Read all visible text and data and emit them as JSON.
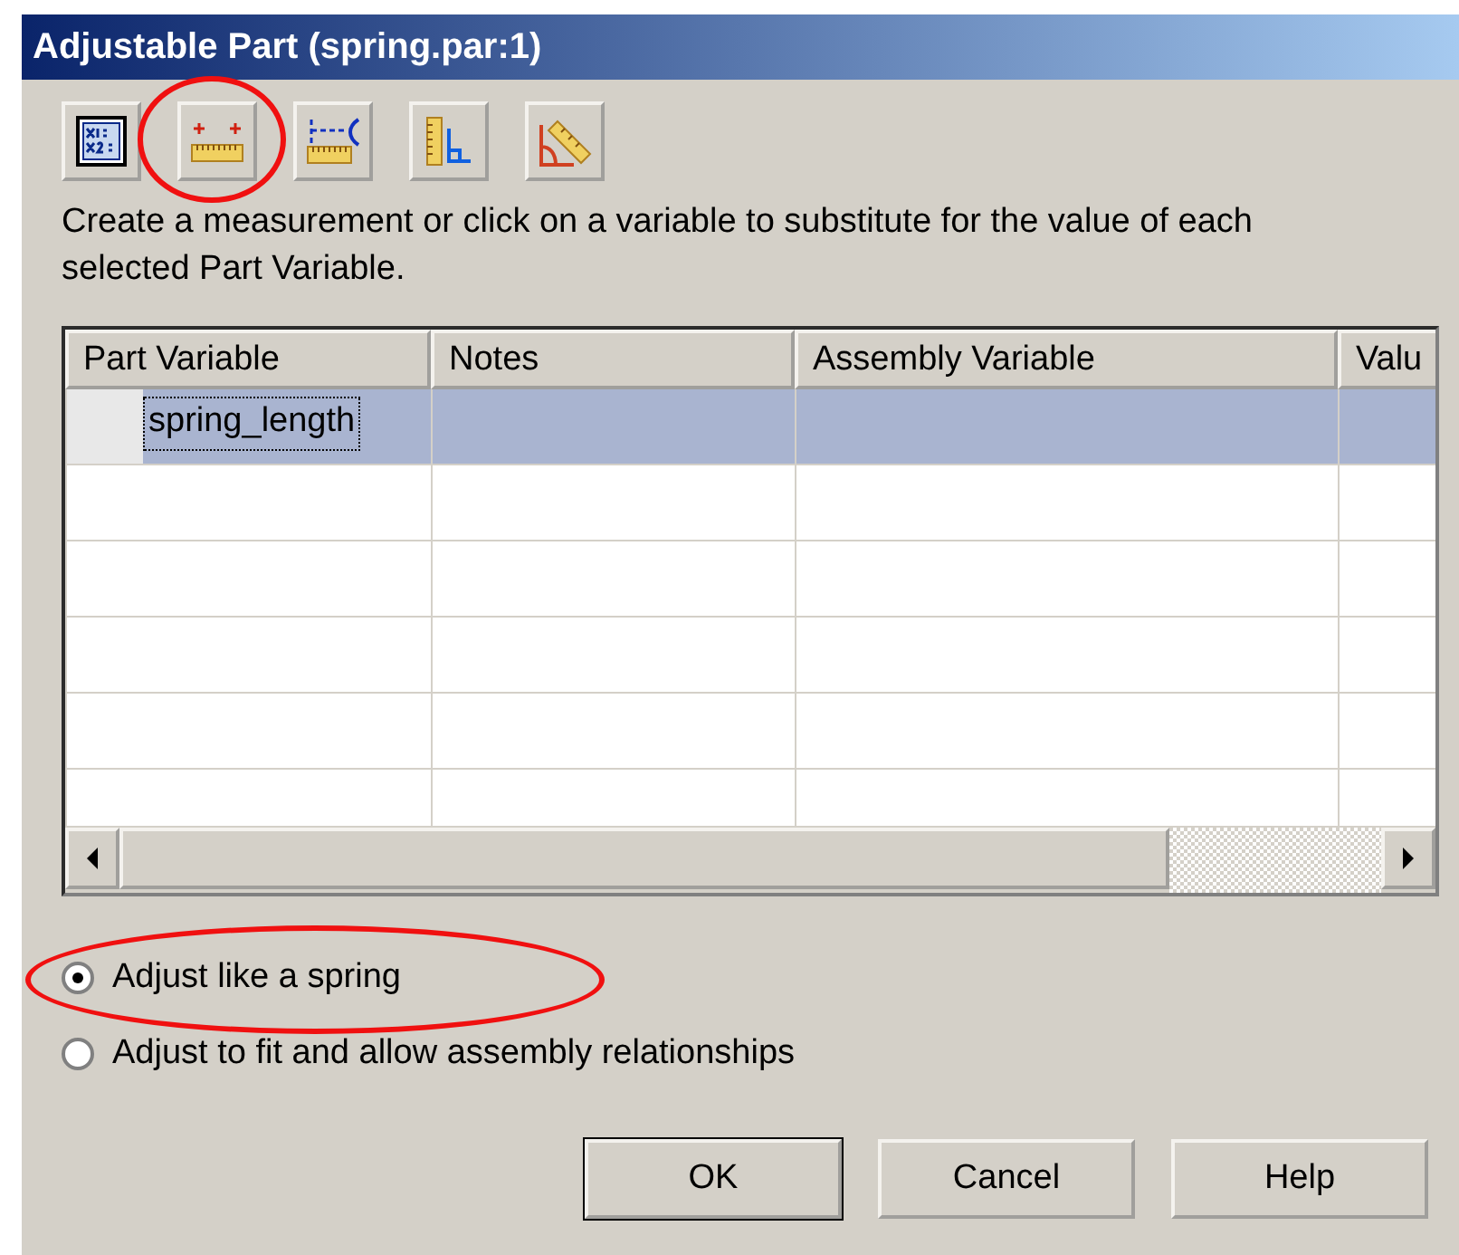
{
  "window": {
    "title": "Adjustable Part (spring.par:1)"
  },
  "toolbar": [
    {
      "kind": "variables",
      "highlighted": false
    },
    {
      "kind": "measure",
      "highlighted": true
    },
    {
      "kind": "dimension",
      "highlighted": false
    },
    {
      "kind": "corner",
      "highlighted": false
    },
    {
      "kind": "angle",
      "highlighted": false
    }
  ],
  "instructions": "Create a measurement or click on a variable to substitute for the value of each selected Part Variable.",
  "table": {
    "columns": [
      "Part Variable",
      "Notes",
      "Assembly Variable",
      "Valu"
    ],
    "rows": [
      {
        "part_variable": "spring_length",
        "selected": true
      },
      {
        "selected": false
      },
      {
        "selected": false
      },
      {
        "selected": false
      },
      {
        "selected": false
      },
      {
        "selected": false
      }
    ]
  },
  "options": [
    {
      "label": "Adjust like a spring",
      "selected": true,
      "highlighted": true
    },
    {
      "label": "Adjust to fit and allow assembly relationships",
      "selected": false,
      "highlighted": false
    }
  ],
  "buttons": [
    {
      "label": "OK",
      "default": true
    },
    {
      "label": "Cancel",
      "default": false
    },
    {
      "label": "Help",
      "default": false
    }
  ]
}
